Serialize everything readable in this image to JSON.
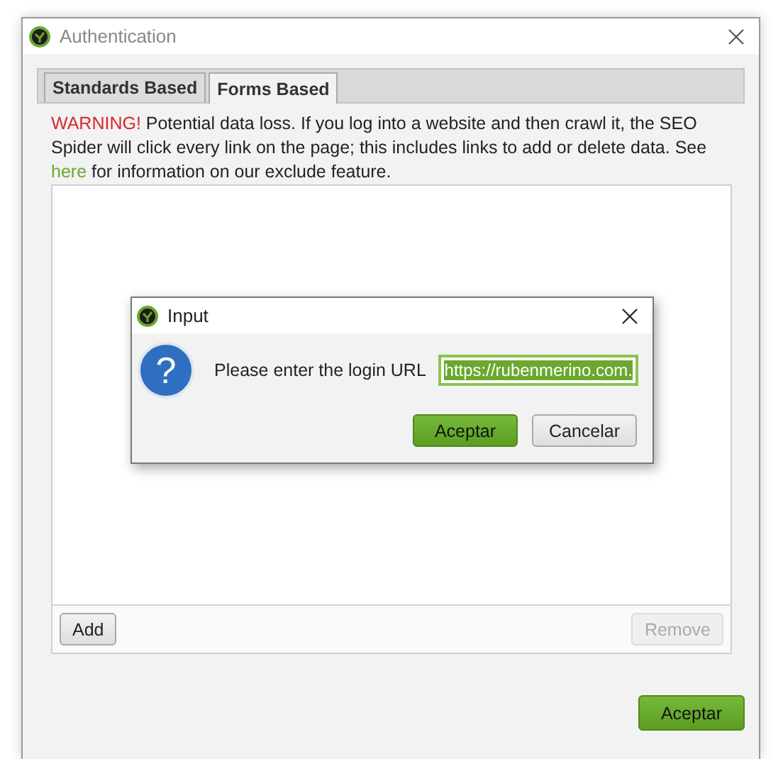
{
  "window": {
    "title": "Authentication"
  },
  "tabs": [
    {
      "label": "Standards Based",
      "selected": false
    },
    {
      "label": "Forms Based",
      "selected": true
    }
  ],
  "warning": {
    "alert": "WARNING!",
    "before": "Potential data loss. If you log into a website and then crawl it, the SEO Spider will click every link on the page; this includes links to add or delete data. See",
    "link": "here",
    "after": "for information on our exclude feature."
  },
  "list_buttons": [
    {
      "label": "Add",
      "disabled": false
    },
    {
      "label": "Remove",
      "disabled": true
    }
  ],
  "footer_button": "Aceptar",
  "dialog": {
    "title": "Input",
    "icon_glyph": "?",
    "prompt": "Please enter the login URL",
    "value": "https://rubenmerino.com.",
    "value_selected": true,
    "buttons": [
      {
        "label": "Aceptar",
        "kind": "primary"
      },
      {
        "label": "Cancelar",
        "kind": "default"
      }
    ]
  }
}
